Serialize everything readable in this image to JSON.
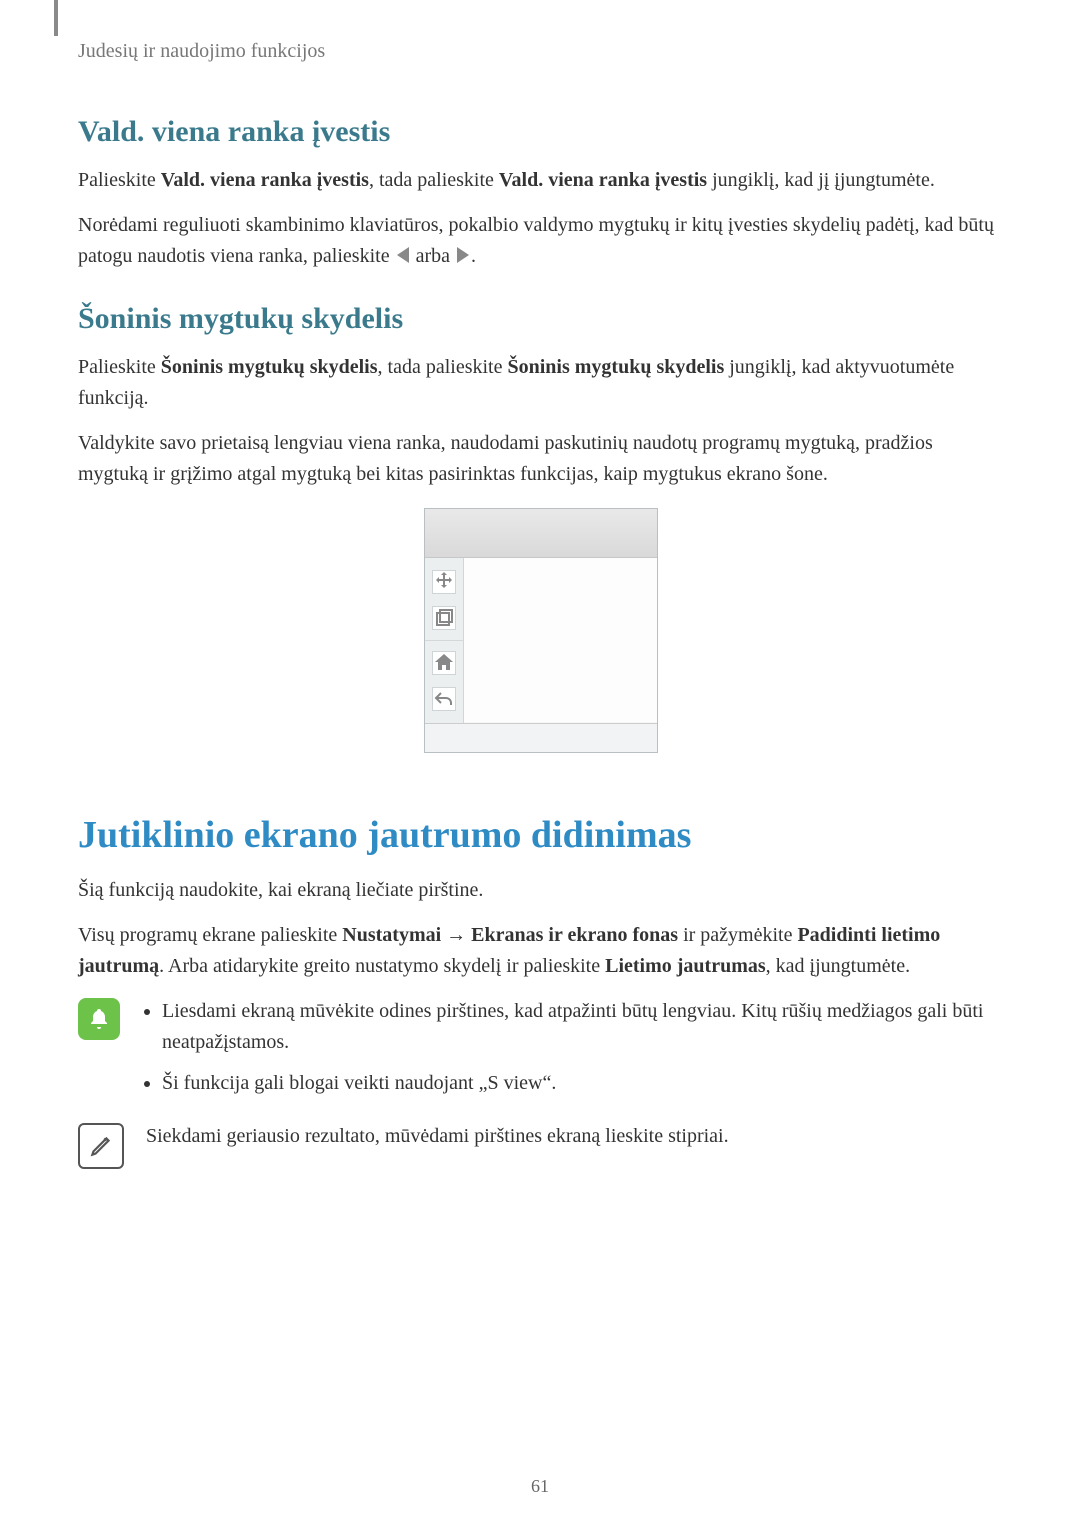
{
  "breadcrumb": "Judesių ir naudojimo funkcijos",
  "section1": {
    "heading": "Vald. viena ranka įvestis",
    "p1_part1": "Palieskite ",
    "p1_bold1": "Vald. viena ranka įvestis",
    "p1_part2": ", tada palieskite ",
    "p1_bold2": "Vald. viena ranka įvestis",
    "p1_part3": " jungiklį, kad jį įjungtumėte.",
    "p2_part1": "Norėdami reguliuoti skambinimo klaviatūros, pokalbio valdymo mygtukų ir kitų įvesties skydelių padėtį, kad būtų patogu naudotis viena ranka, palieskite ",
    "p2_mid": " arba ",
    "p2_end": "."
  },
  "section2": {
    "heading": "Šoninis mygtukų skydelis",
    "p1_part1": "Palieskite ",
    "p1_bold1": "Šoninis mygtukų skydelis",
    "p1_part2": ", tada palieskite ",
    "p1_bold2": "Šoninis mygtukų skydelis",
    "p1_part3": " jungiklį, kad aktyvuotumėte funkciją.",
    "p2": "Valdykite savo prietaisą lengviau viena ranka, naudodami paskutinių naudotų programų mygtuką, pradžios mygtuką ir grįžimo atgal mygtuką bei kitas pasirinktas funkcijas, kaip mygtukus ekrano šone."
  },
  "section3": {
    "heading": "Jutiklinio ekrano jautrumo didinimas",
    "p1": "Šią funkciją naudokite, kai ekraną liečiate pirštine.",
    "p2_part1": "Visų programų ekrane palieskite ",
    "p2_bold1": "Nustatymai",
    "p2_arrow": " → ",
    "p2_bold2": "Ekranas ir ekrano fonas",
    "p2_part2": " ir pažymėkite ",
    "p2_bold3": "Padidinti lietimo jautrumą",
    "p2_part3": ". Arba atidarykite greito nustatymo skydelį ir palieskite ",
    "p2_bold4": "Lietimo jautrumas",
    "p2_part4": ", kad įjungtumėte.",
    "bullets": [
      "Liesdami ekraną mūvėkite odines pirštines, kad atpažinti būtų lengviau. Kitų rūšių medžiagos gali būti neatpažįstamos.",
      "Ši funkcija gali blogai veikti naudojant „S view“."
    ],
    "note": "Siekdami geriausio rezultato, mūvėdami pirštines ekraną lieskite stipriai."
  },
  "page_number": "61"
}
